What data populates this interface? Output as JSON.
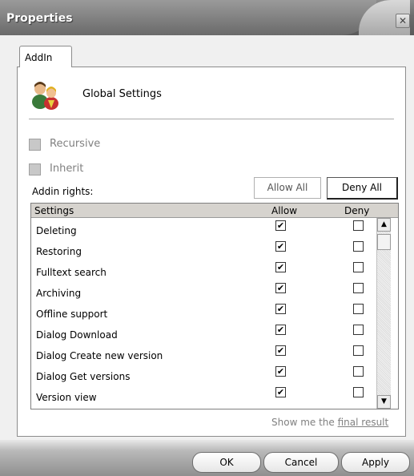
{
  "window": {
    "title": "Properties",
    "close_glyph": "✕"
  },
  "tabs": [
    {
      "label": "AddIn"
    }
  ],
  "header": {
    "icon": "users-group-icon",
    "label": "Global Settings"
  },
  "options": [
    {
      "label": "Recursive",
      "checked": false,
      "enabled": false
    },
    {
      "label": "Inherit",
      "checked": false,
      "enabled": false
    }
  ],
  "rights": {
    "label": "Addin rights:",
    "allow_all": "Allow All",
    "deny_all": "Deny All",
    "columns": {
      "settings": "Settings",
      "allow": "Allow",
      "deny": "Deny"
    },
    "rows": [
      {
        "name": "Deleting",
        "allow": true,
        "deny": false
      },
      {
        "name": "Restoring",
        "allow": true,
        "deny": false
      },
      {
        "name": "Fulltext search",
        "allow": true,
        "deny": false
      },
      {
        "name": "Archiving",
        "allow": true,
        "deny": false
      },
      {
        "name": "Offline support",
        "allow": true,
        "deny": false
      },
      {
        "name": "Dialog Download",
        "allow": true,
        "deny": false
      },
      {
        "name": "Dialog Create new version",
        "allow": true,
        "deny": false
      },
      {
        "name": "Dialog Get versions",
        "allow": true,
        "deny": false
      },
      {
        "name": "Version view",
        "allow": true,
        "deny": false
      }
    ]
  },
  "result": {
    "prefix": "Show me the",
    "link": "final result"
  },
  "footer": {
    "ok": "OK",
    "cancel": "Cancel",
    "apply": "Apply"
  }
}
